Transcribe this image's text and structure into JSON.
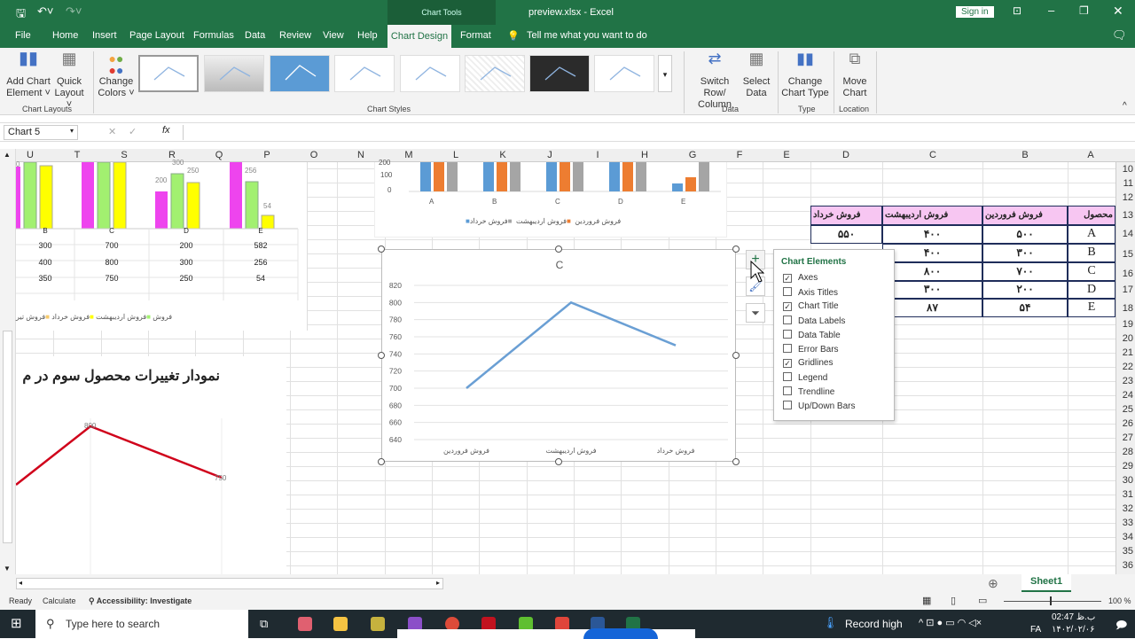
{
  "titlebar": {
    "file_title": "preview.xlsx - Excel",
    "chart_tools": "Chart Tools",
    "sign_in": "Sign in"
  },
  "tabs": [
    "File",
    "Home",
    "Insert",
    "Page Layout",
    "Formulas",
    "Data",
    "Review",
    "View",
    "Help",
    "Chart Design",
    "Format"
  ],
  "tell_me": "Tell me what you want to do",
  "ribbon": {
    "add_chart_element": [
      "Add Chart",
      "Element ˅"
    ],
    "quick_layout": [
      "Quick",
      "Layout ˅"
    ],
    "change_colors": [
      "Change",
      "Colors ˅"
    ],
    "switch_row_column": [
      "Switch Row/",
      "Column"
    ],
    "select_data": [
      "Select",
      "Data"
    ],
    "change_chart_type": [
      "Change",
      "Chart Type"
    ],
    "move_chart": [
      "Move",
      "Chart"
    ],
    "groups": {
      "chart_layouts": "Chart Layouts",
      "chart_styles": "Chart Styles",
      "data": "Data",
      "type": "Type",
      "location": "Location"
    }
  },
  "namebox": "Chart 5",
  "columns": [
    [
      "A",
      1230
    ],
    [
      "B",
      1156
    ],
    [
      "C",
      1052
    ],
    [
      "D",
      954
    ],
    [
      "E",
      887
    ],
    [
      "F",
      834
    ],
    [
      "G",
      781
    ],
    [
      "H",
      727
    ],
    [
      "I",
      674
    ],
    [
      "J",
      620
    ],
    [
      "K",
      567
    ],
    [
      "L",
      514
    ],
    [
      "M",
      461
    ],
    [
      "N",
      407
    ],
    [
      "O",
      354
    ],
    [
      "P",
      301
    ],
    [
      "Q",
      247
    ],
    [
      "R",
      194
    ],
    [
      "S",
      140
    ],
    [
      "T",
      87
    ],
    [
      "U",
      34
    ]
  ],
  "rows": [
    "10",
    "11",
    "12",
    "13",
    "14",
    "15",
    "16",
    "17",
    "18",
    "19",
    "20",
    "21",
    "22",
    "23",
    "24",
    "25",
    "26",
    "27",
    "28",
    "29",
    "30",
    "31",
    "32",
    "33",
    "34",
    "35",
    "36"
  ],
  "table": {
    "headers": [
      "محصول",
      "فروش فروردین",
      "فروش اردیبهشت",
      "فروش خرداد"
    ],
    "rows": [
      [
        "A",
        "۵۰۰",
        "۴۰۰",
        "۵۵۰"
      ],
      [
        "B",
        "۳۰۰",
        "۴۰۰",
        ""
      ],
      [
        "C",
        "۷۰۰",
        "۸۰۰",
        ""
      ],
      [
        "D",
        "۲۰۰",
        "۳۰۰",
        ""
      ],
      [
        "E",
        "۵۴",
        "۸۷",
        ""
      ]
    ]
  },
  "left_chart": {
    "bar_labels": [
      "0",
      "300",
      "250",
      "200",
      "256",
      "54"
    ],
    "categories": [
      "B",
      "C",
      "D",
      "E"
    ],
    "table_rows": [
      [
        "300",
        "700",
        "200",
        "582"
      ],
      [
        "400",
        "800",
        "300",
        "256"
      ],
      [
        "350",
        "750",
        "250",
        "54"
      ]
    ],
    "legend": [
      "فروش اردیبهشت",
      "فروش خرداد",
      "فروش تیر",
      "فروش"
    ]
  },
  "top_chart": {
    "y_ticks": [
      "200",
      "100",
      "0"
    ],
    "categories": [
      "A",
      "B",
      "C",
      "D",
      "E"
    ],
    "legend": [
      "فروش فروردین",
      "فروش اردیبهشت",
      "فروش خرداد"
    ],
    "colors": [
      "#5b9bd5",
      "#ed7d31",
      "#a5a5a5"
    ]
  },
  "bottom_left_chart": {
    "title": "نمودار تغییرات محصول سوم در م",
    "labels": [
      "800",
      "750"
    ],
    "color": "#d0021b"
  },
  "chart_data": {
    "type": "line",
    "title": "C",
    "categories": [
      "فروش فروردین",
      "فروش اردیبهشت",
      "فروش خرداد"
    ],
    "values": [
      700,
      800,
      750
    ],
    "ylim": [
      640,
      820
    ],
    "y_ticks": [
      640,
      660,
      680,
      700,
      720,
      740,
      760,
      780,
      800,
      820
    ],
    "grid": true,
    "color": "#6a9fd4"
  },
  "chart_elements": {
    "title": "Chart Elements",
    "items": [
      [
        "Axes",
        true
      ],
      [
        "Axis Titles",
        false
      ],
      [
        "Chart Title",
        true
      ],
      [
        "Data Labels",
        false
      ],
      [
        "Data Table",
        false
      ],
      [
        "Error Bars",
        false
      ],
      [
        "Gridlines",
        true
      ],
      [
        "Legend",
        false
      ],
      [
        "Trendline",
        false
      ],
      [
        "Up/Down Bars",
        false
      ]
    ]
  },
  "sheet_tab": "Sheet1",
  "status": {
    "ready": "Ready",
    "calculate": "Calculate",
    "accessibility": "Accessibility: Investigate",
    "zoom": "100 %"
  },
  "taskbar": {
    "search": "Type here to search",
    "weather": "Record high",
    "lang": "FA",
    "time": "02:47 ب.ظ",
    "date": "۱۴۰۲/۰۲/۰۶"
  }
}
